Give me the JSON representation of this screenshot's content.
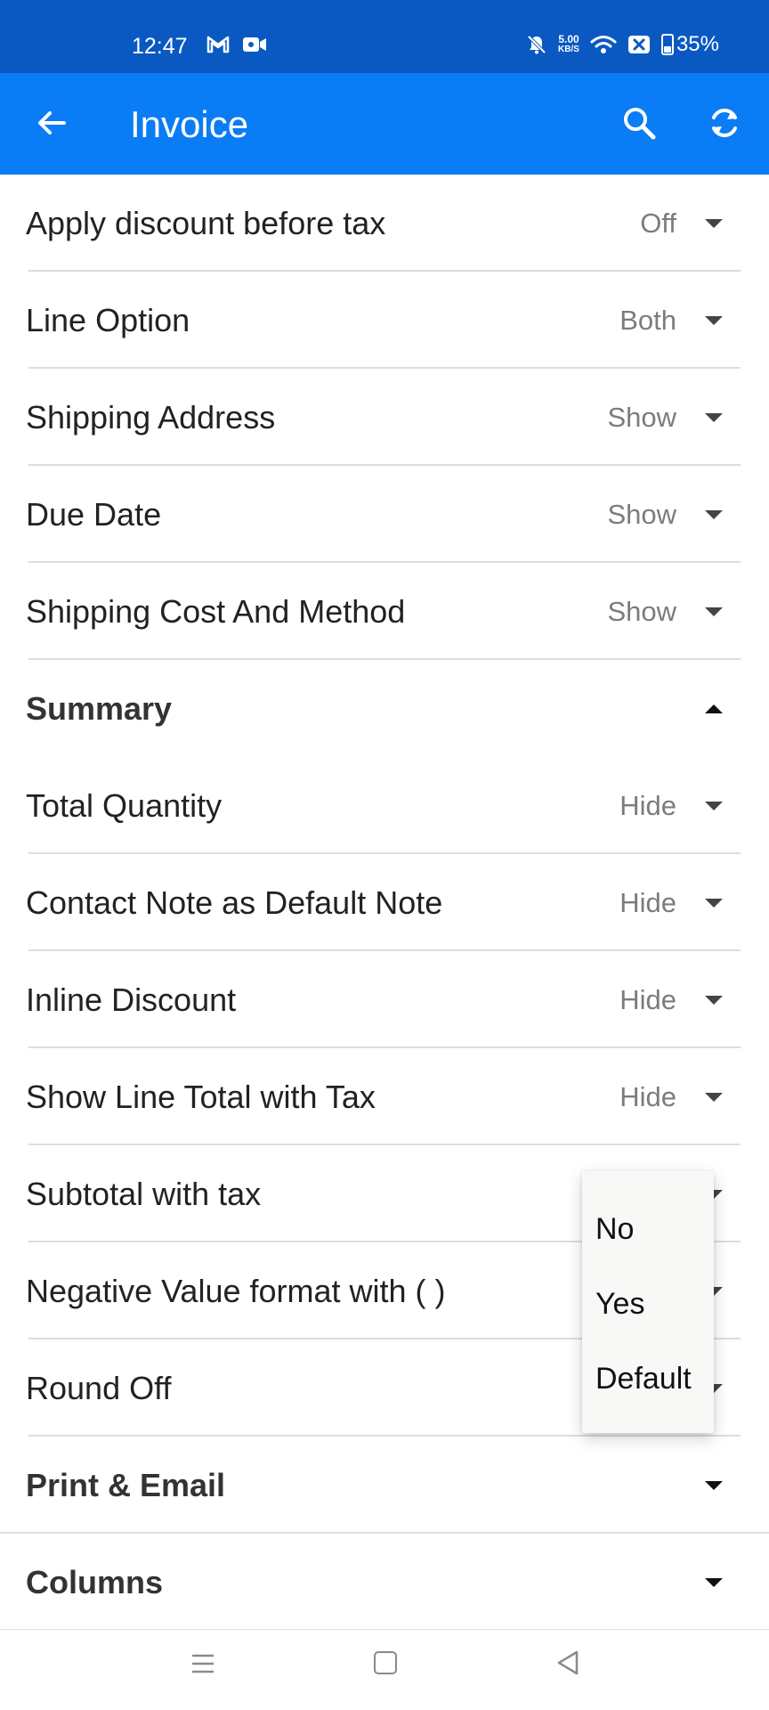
{
  "status_bar": {
    "time": "12:47",
    "net_speed_value": "5.00",
    "net_speed_unit": "KB/S",
    "battery": "35%",
    "battery_level": 0.35
  },
  "app_bar": {
    "title": "Invoice"
  },
  "rows": [
    {
      "label": "Apply discount before tax",
      "value": "Off"
    },
    {
      "label": "Line Option",
      "value": "Both"
    },
    {
      "label": "Shipping Address",
      "value": "Show"
    },
    {
      "label": "Due Date",
      "value": "Show"
    },
    {
      "label": "Shipping Cost And Method",
      "value": "Show"
    }
  ],
  "summary": {
    "title": "Summary",
    "rows": [
      {
        "label": "Total Quantity",
        "value": "Hide"
      },
      {
        "label": "Contact Note as Default Note",
        "value": "Hide"
      },
      {
        "label": "Inline Discount",
        "value": "Hide"
      },
      {
        "label": "Show Line Total with Tax",
        "value": "Hide"
      },
      {
        "label": "Subtotal with tax",
        "value": ""
      },
      {
        "label": "Negative Value format with ( )",
        "value": ""
      },
      {
        "label": "Round Off",
        "value": ""
      }
    ]
  },
  "sections": {
    "print_email": "Print & Email",
    "columns": "Columns"
  },
  "dropdown": {
    "options": [
      "No",
      "Yes",
      "Default"
    ]
  },
  "colors": {
    "status_bar": "#0a59c2",
    "app_bar": "#0a7cf5"
  }
}
